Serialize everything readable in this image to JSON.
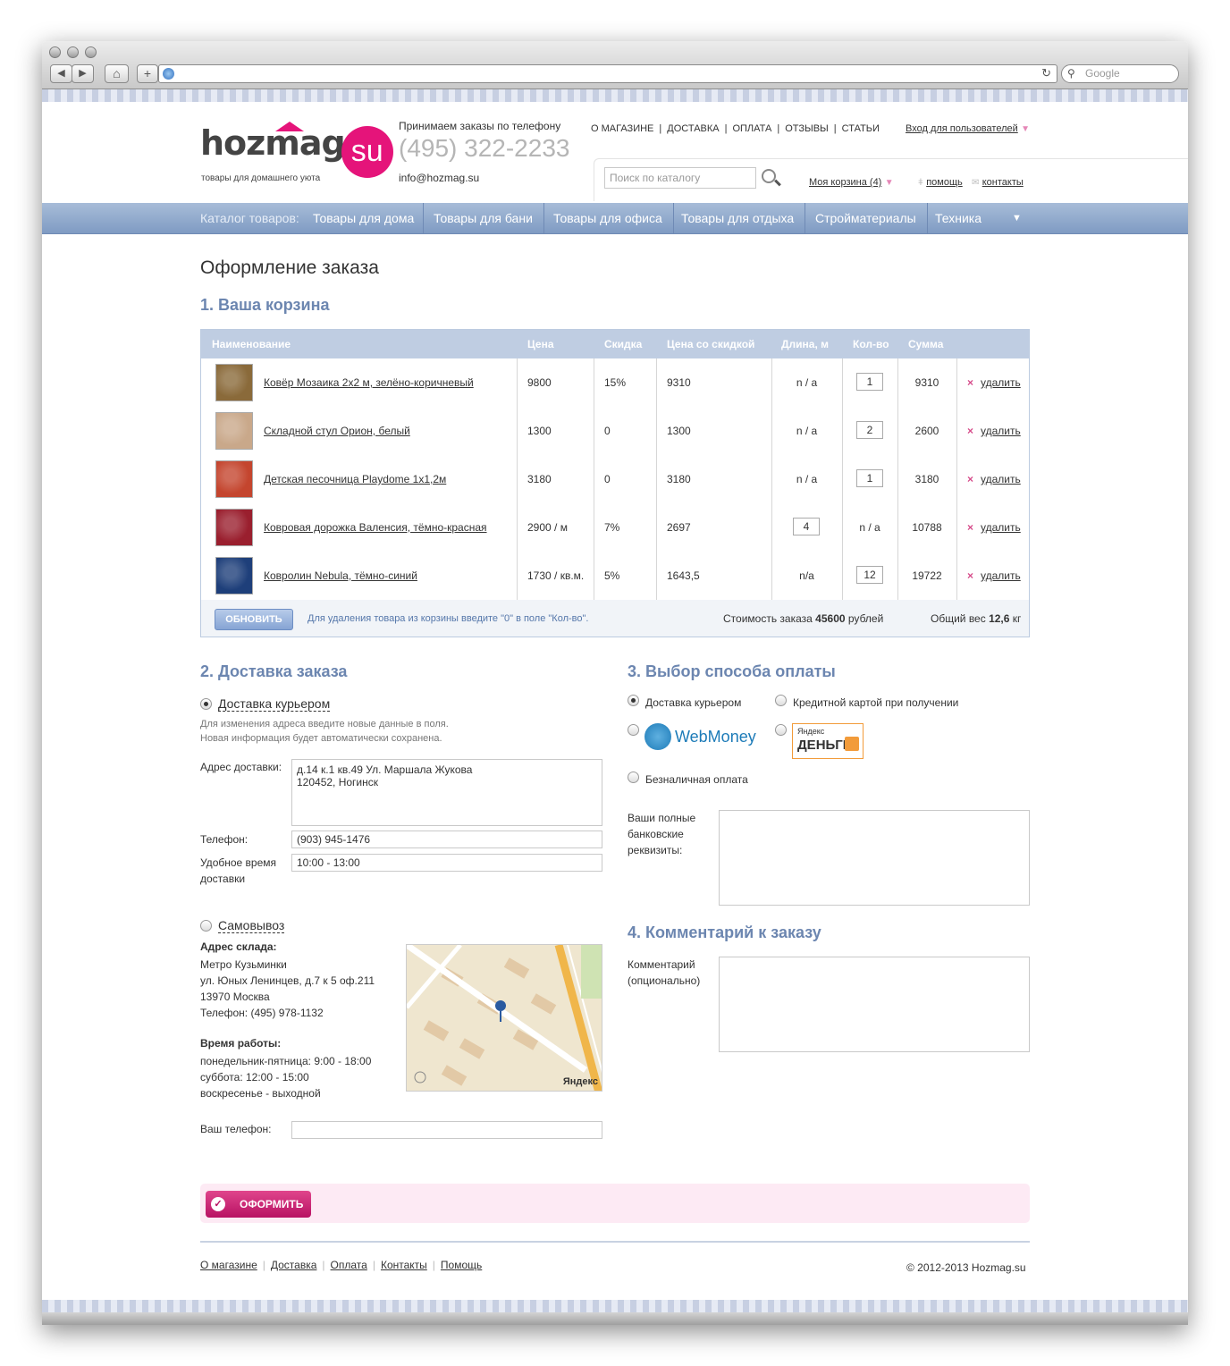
{
  "browser": {
    "nav_back": "◀",
    "nav_fwd": "▶",
    "home": "⌂",
    "new_tab": "+",
    "reload": "↻",
    "search_placeholder": "Google"
  },
  "header": {
    "logo_main": "hozmag",
    "logo_su": "su",
    "tagline": "товары для домашнего уюта",
    "phone_caption": "Принимаем заказы по телефону",
    "phone": "(495) 322-2233",
    "email": "info@hozmag.su",
    "topnav": [
      "О МАГАЗИНЕ",
      "ДОСТАВКА",
      "ОПЛАТА",
      "ОТЗЫВЫ",
      "СТАТЬИ"
    ],
    "login": "Вход для пользователей",
    "search_placeholder": "Поиск по каталогу",
    "cart_link": "Моя корзина (4)",
    "help": "помощь",
    "contacts": "контакты"
  },
  "menu": {
    "label": "Каталог товаров:",
    "items": [
      "Товары для дома",
      "Товары для бани",
      "Товары для офиса",
      "Товары для отдыха",
      "Стройматериалы",
      "Техника"
    ],
    "more": "▼"
  },
  "page_title": "Оформление заказа",
  "cart": {
    "title": "1. Ваша корзина",
    "columns": [
      "Наименование",
      "Цена",
      "Скидка",
      "Цена со скидкой",
      "Длина, м",
      "Кол-во",
      "Сумма"
    ],
    "rows": [
      {
        "name": "Ковёр Мозаика 2x2 м, зелёно-коричневый",
        "price": "9800",
        "discount": "15%",
        "disc_price": "9310",
        "length": "n / a",
        "qty": "1",
        "sum": "9310",
        "thumb": "#8a6a3a"
      },
      {
        "name": "Складной стул Орион, белый",
        "price": "1300",
        "discount": "0",
        "disc_price": "1300",
        "length": "n / a",
        "qty": "2",
        "sum": "2600",
        "thumb": "#c9a88a"
      },
      {
        "name": "Детская песочница Playdome 1x1,2м",
        "price": "3180",
        "discount": "0",
        "disc_price": "3180",
        "length": "n / a",
        "qty": "1",
        "sum": "3180",
        "thumb": "#c4452e"
      },
      {
        "name": "Ковровая дорожка Валенсия, тёмно-красная",
        "price": "2900 / м",
        "discount": "7%",
        "disc_price": "2697",
        "length": "4",
        "qty": "n / a",
        "sum": "10788",
        "thumb": "#9a1f2e"
      },
      {
        "name": "Ковролин Nebula, тёмно-синий",
        "price": "1730 / кв.м.",
        "discount": "5%",
        "disc_price": "1643,5",
        "length": "n/a",
        "qty": "12",
        "sum": "19722",
        "thumb": "#1e3f7a"
      }
    ],
    "delete_label": "удалить",
    "update_btn": "ОБНОВИТЬ",
    "hint": "Для удаления товара из корзины введите \"0\" в поле \"Кол-во\".",
    "total_label": "Стоимость заказа",
    "total_value": "45600",
    "total_unit": "рублей",
    "weight_label": "Общий вес",
    "weight_value": "12,6",
    "weight_unit": "кг"
  },
  "delivery": {
    "title": "2. Доставка заказа",
    "courier_label": "Доставка курьером",
    "note1": "Для изменения адреса введите новые данные в поля.",
    "note2": "Новая информация будет автоматически сохранена.",
    "address_label": "Адрес доставки:",
    "address_line1": "д.14 к.1 кв.49  Ул. Маршала Жукова",
    "address_line2": "120452, Ногинск",
    "phone_label": "Телефон:",
    "phone_value": "(903) 945-1476",
    "time_label1": "Удобное время",
    "time_label2": "доставки",
    "time_value": "10:00 - 13:00",
    "pickup_label": "Самовывоз",
    "warehouse_title": "Адрес склада:",
    "warehouse_lines": [
      "Метро Кузьминки",
      "ул. Юных Ленинцев, д.7 к 5 оф.211",
      "13970 Москва",
      "Телефон: (495) 978-1132"
    ],
    "hours_title": "Время работы:",
    "hours_lines": [
      "понедельник-пятница: 9:00 - 18:00",
      "суббота: 12:00 - 15:00",
      "воскресенье - выходной"
    ],
    "your_phone_label": "Ваш телефон:",
    "map_logo": "Яндекс"
  },
  "payment": {
    "title": "3. Выбор способа оплаты",
    "opt_courier": "Доставка курьером",
    "opt_card": "Кредитной картой при получении",
    "webmoney": "WebMoney",
    "yandex_top": "Яндекс",
    "yandex_bottom": "ДЕНЬГИ",
    "opt_cashless": "Безналичная оплата",
    "bank_label1": "Ваши полные",
    "bank_label2": "банковские",
    "bank_label3": "реквизиты:"
  },
  "comment": {
    "title": "4. Комментарий к заказу",
    "label1": "Комментарий",
    "label2": "(опционально)"
  },
  "submit_label": "ОФОРМИТЬ",
  "footer": {
    "links": [
      "О магазине",
      "Доставка",
      "Оплата",
      "Контакты",
      "Помощь"
    ],
    "copyright": "© 2012-2013 Hozmag.su"
  }
}
